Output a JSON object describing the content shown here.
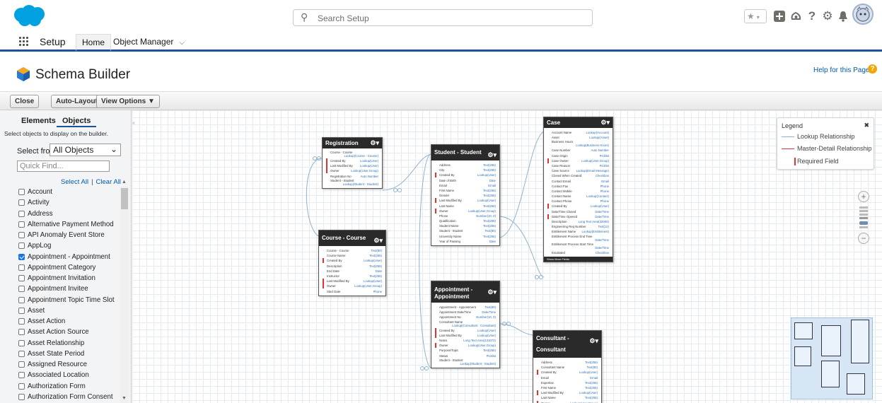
{
  "header": {
    "search_placeholder": "Search Setup",
    "icons": [
      "star-icon",
      "chevron-down-icon",
      "plus-icon",
      "trailhead-icon",
      "help-icon",
      "gear-icon",
      "bell-icon",
      "avatar"
    ]
  },
  "nav": {
    "title": "Setup",
    "tabs": [
      {
        "label": "Home",
        "selected": true
      },
      {
        "label": "Object Manager",
        "selected": false
      }
    ]
  },
  "page": {
    "title": "Schema Builder",
    "help_link": "Help for this Page"
  },
  "toolbar": {
    "close": "Close",
    "auto_layout": "Auto-Layout",
    "view_options": "View Options ▼"
  },
  "sidebar": {
    "tabs": [
      "Elements",
      "Objects"
    ],
    "hint": "Select objects to display on the builder.",
    "select_from_label": "Select from",
    "select_from_value": "All Objects",
    "quick_find_placeholder": "Quick Find...",
    "select_all": "Select All",
    "clear_all": "Clear All",
    "objects": [
      {
        "name": "Account",
        "checked": false
      },
      {
        "name": "Activity",
        "checked": false
      },
      {
        "name": "Address",
        "checked": false
      },
      {
        "name": "Alternative Payment Method",
        "checked": false
      },
      {
        "name": "API Anomaly Event Store",
        "checked": false
      },
      {
        "name": "AppLog",
        "checked": false
      },
      {
        "name": "Appointment - Appointment",
        "checked": true
      },
      {
        "name": "Appointment Category",
        "checked": false
      },
      {
        "name": "Appointment Invitation",
        "checked": false
      },
      {
        "name": "Appointment Invitee",
        "checked": false
      },
      {
        "name": "Appointment Topic Time Slot",
        "checked": false
      },
      {
        "name": "Asset",
        "checked": false
      },
      {
        "name": "Asset Action",
        "checked": false
      },
      {
        "name": "Asset Action Source",
        "checked": false
      },
      {
        "name": "Asset Relationship",
        "checked": false
      },
      {
        "name": "Asset State Period",
        "checked": false
      },
      {
        "name": "Assigned Resource",
        "checked": false
      },
      {
        "name": "Associated Location",
        "checked": false
      },
      {
        "name": "Authorization Form",
        "checked": false
      },
      {
        "name": "Authorization Form Consent",
        "checked": false
      }
    ]
  },
  "legend": {
    "title": "Legend",
    "close": "✖",
    "lookup": "Lookup Relationship",
    "master_detail": "Master-Detail Relationship",
    "required": "Required Field"
  },
  "entities": {
    "registration": {
      "title": "Registration",
      "fields": [
        {
          "n": "Course - Course",
          "t": "Lookup(Course - Course)",
          "two": true
        },
        {
          "n": "Created By",
          "t": "Lookup(User)",
          "rq": true
        },
        {
          "n": "Last Modified By",
          "t": "Lookup(User)",
          "rq": true
        },
        {
          "n": "Owner",
          "t": "Lookup(User,Group)",
          "rq": true
        },
        {
          "n": "Registration No",
          "t": "Auto Number"
        },
        {
          "n": "Student - Student",
          "t": "Lookup(Student - Student)",
          "two": true
        }
      ]
    },
    "course": {
      "title": "Course - Course",
      "fields": [
        {
          "n": "Course - Course",
          "t": "Text(80)"
        },
        {
          "n": "Course Name",
          "t": "Text(255)"
        },
        {
          "n": "Created By",
          "t": "Lookup(User)",
          "rq": true
        },
        {
          "n": "Description",
          "t": "Text(255)"
        },
        {
          "n": "End Date",
          "t": "Date"
        },
        {
          "n": "Instructor",
          "t": "Text(255)"
        },
        {
          "n": "Last Modified By",
          "t": "Lookup(User)",
          "rq": true
        },
        {
          "n": "Owner",
          "t": "Lookup(User,Group)",
          "rq": true
        },
        {
          "n": "Start Date",
          "t": "Phone"
        }
      ]
    },
    "student": {
      "title": "Student - Student",
      "fields": [
        {
          "n": "Address",
          "t": "Text(255)"
        },
        {
          "n": "City",
          "t": "Text(255)"
        },
        {
          "n": "Created By",
          "t": "Lookup(User)",
          "rq": true
        },
        {
          "n": "Date of Birth",
          "t": "Date"
        },
        {
          "n": "Email",
          "t": "Email"
        },
        {
          "n": "First Name",
          "t": "Text(255)"
        },
        {
          "n": "Gender",
          "t": "Text(255)"
        },
        {
          "n": "Last Modified By",
          "t": "Lookup(User)",
          "rq": true
        },
        {
          "n": "Last Name",
          "t": "Text(255)"
        },
        {
          "n": "Owner",
          "t": "Lookup(User,Group)",
          "rq": true
        },
        {
          "n": "Phone",
          "t": "Number(10, 0)"
        },
        {
          "n": "Qualification",
          "t": "Text(255)"
        },
        {
          "n": "Student Name",
          "t": "Text(255)"
        },
        {
          "n": "Student - Student",
          "t": "Text(80)"
        },
        {
          "n": "University Name",
          "t": "Text(255)"
        },
        {
          "n": "Year of Passing",
          "t": "Date"
        }
      ]
    },
    "appointment": {
      "title": "Appointment - Appointment",
      "fields": [
        {
          "n": "Appointment - Appointment",
          "t": "Text(80)"
        },
        {
          "n": "Appointment Date/Time",
          "t": "Date/Time"
        },
        {
          "n": "Appointment No",
          "t": "Number(10, 0)"
        },
        {
          "n": "Consultant Name",
          "t": "Lookup(Consultant - Consultant)",
          "two": true
        },
        {
          "n": "Created By",
          "t": "Lookup(User)",
          "rq": true
        },
        {
          "n": "Last Modified By",
          "t": "Lookup(User)",
          "rq": true
        },
        {
          "n": "Notes",
          "t": "Long Text Area(131072)"
        },
        {
          "n": "Owner",
          "t": "Lookup(User,Group)",
          "rq": true
        },
        {
          "n": "Purpose/Topic",
          "t": "Text(255)"
        },
        {
          "n": "Status",
          "t": "Picklist"
        },
        {
          "n": "Student - Student",
          "t": "Lookup(Student - Student)",
          "two": true
        }
      ]
    },
    "case": {
      "title": "Case",
      "more": "Show More Fields",
      "fields": [
        {
          "n": "Account Name",
          "t": "Lookup(Account)"
        },
        {
          "n": "Asset",
          "t": "Lookup(Asset)"
        },
        {
          "n": "Business Hours",
          "t": "Lookup(Business Hours)",
          "two": true
        },
        {
          "n": "Case Number",
          "t": "Auto Number"
        },
        {
          "n": "Case Origin",
          "t": "Picklist"
        },
        {
          "n": "Case Owner",
          "t": "Lookup(User,Group)",
          "rq": true
        },
        {
          "n": "Case Reason",
          "t": "Picklist"
        },
        {
          "n": "Case Source",
          "t": "Lookup(Email Message)"
        },
        {
          "n": "Closed When Created",
          "t": "Checkbox"
        },
        {
          "n": "Contact Email",
          "t": "Email"
        },
        {
          "n": "Contact Fax",
          "t": "Phone"
        },
        {
          "n": "Contact Mobile",
          "t": "Phone"
        },
        {
          "n": "Contact Name",
          "t": "Lookup(Contact)"
        },
        {
          "n": "Contact Phone",
          "t": "Phone"
        },
        {
          "n": "Created By",
          "t": "Lookup(User)",
          "rq": true
        },
        {
          "n": "Date/Time Closed",
          "t": "Date/Time"
        },
        {
          "n": "Date/Time Opened",
          "t": "Date/Time",
          "rq": true
        },
        {
          "n": "Description",
          "t": "Long Text Area(32000)"
        },
        {
          "n": "Engineering Req Number",
          "t": "Text(12)"
        },
        {
          "n": "Entitlement Name",
          "t": "Lookup(Entitlement)"
        },
        {
          "n": "Entitlement Process End Time",
          "t": "Date/Time",
          "two": true
        },
        {
          "n": "Entitlement Process Start Time",
          "t": "Date/Time",
          "two": true
        },
        {
          "n": "Escalated",
          "t": "Checkbox"
        }
      ]
    },
    "consultant": {
      "title": "Consultant - Consultant",
      "fields": [
        {
          "n": "Address",
          "t": "Text(255)"
        },
        {
          "n": "Consultant Name",
          "t": "Text(80)"
        },
        {
          "n": "Created By",
          "t": "Lookup(User)",
          "rq": true
        },
        {
          "n": "Email",
          "t": "Email"
        },
        {
          "n": "Expertise",
          "t": "Text(255)"
        },
        {
          "n": "First Name",
          "t": "Text(255)"
        },
        {
          "n": "Last Modified By",
          "t": "Lookup(User)",
          "rq": true
        },
        {
          "n": "Last Name",
          "t": "Text(255)"
        },
        {
          "n": "Owner",
          "t": "Lookup(User,Group)",
          "rq": true
        }
      ]
    }
  },
  "zoom": {
    "in": "+",
    "out": "−"
  },
  "colors": {
    "brand": "#1b5297",
    "logo": "#00a1e0",
    "required": "#dd3333",
    "link": "#015ba7"
  }
}
